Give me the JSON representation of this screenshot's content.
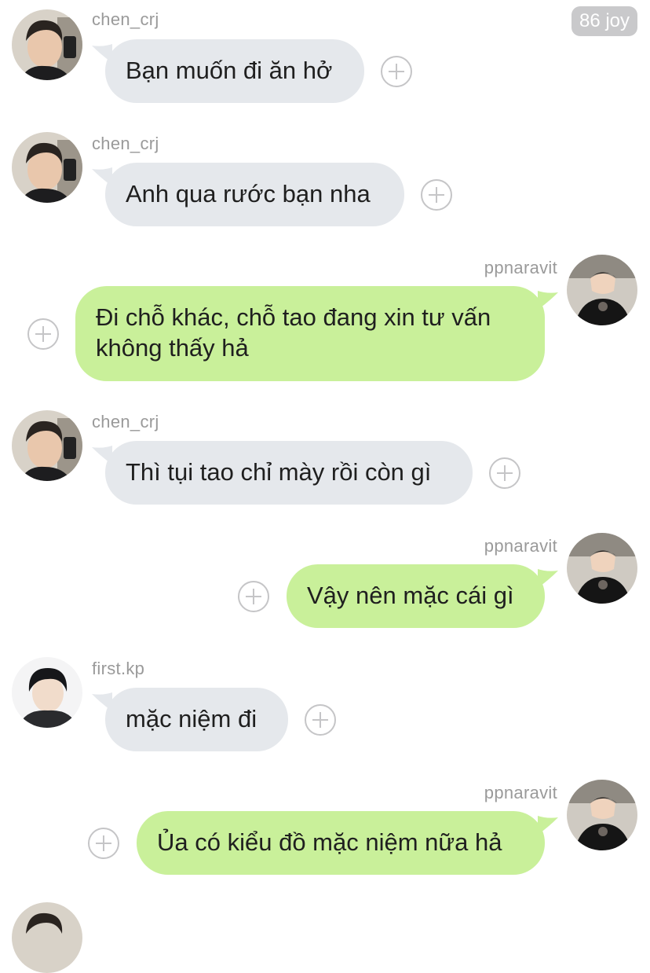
{
  "header": {
    "badge_label": "86 joy"
  },
  "colors": {
    "incoming_bubble": "#e5e8ec",
    "outgoing_bubble": "#c9f09a",
    "username": "#9a9a9a",
    "badge_bg": "#c9c9cb"
  },
  "messages": [
    {
      "sender": "chen_crj",
      "direction": "incoming",
      "text": "Bạn muốn đi ăn hở"
    },
    {
      "sender": "chen_crj",
      "direction": "incoming",
      "text": "Anh qua rước bạn nha"
    },
    {
      "sender": "ppnaravit",
      "direction": "outgoing",
      "text": "Đi chỗ khác, chỗ tao đang xin tư vấn không thấy hả"
    },
    {
      "sender": "chen_crj",
      "direction": "incoming",
      "text": "Thì tụi tao chỉ mày rồi còn gì"
    },
    {
      "sender": "ppnaravit",
      "direction": "outgoing",
      "text": "Vậy nên mặc cái gì"
    },
    {
      "sender": "first.kp",
      "direction": "incoming",
      "text": "mặc niệm đi"
    },
    {
      "sender": "ppnaravit",
      "direction": "outgoing",
      "text": "Ủa có kiểu đồ mặc niệm nữa hả"
    }
  ],
  "icons": {
    "react": "plus-circle-icon",
    "avatar": "user-avatar"
  }
}
